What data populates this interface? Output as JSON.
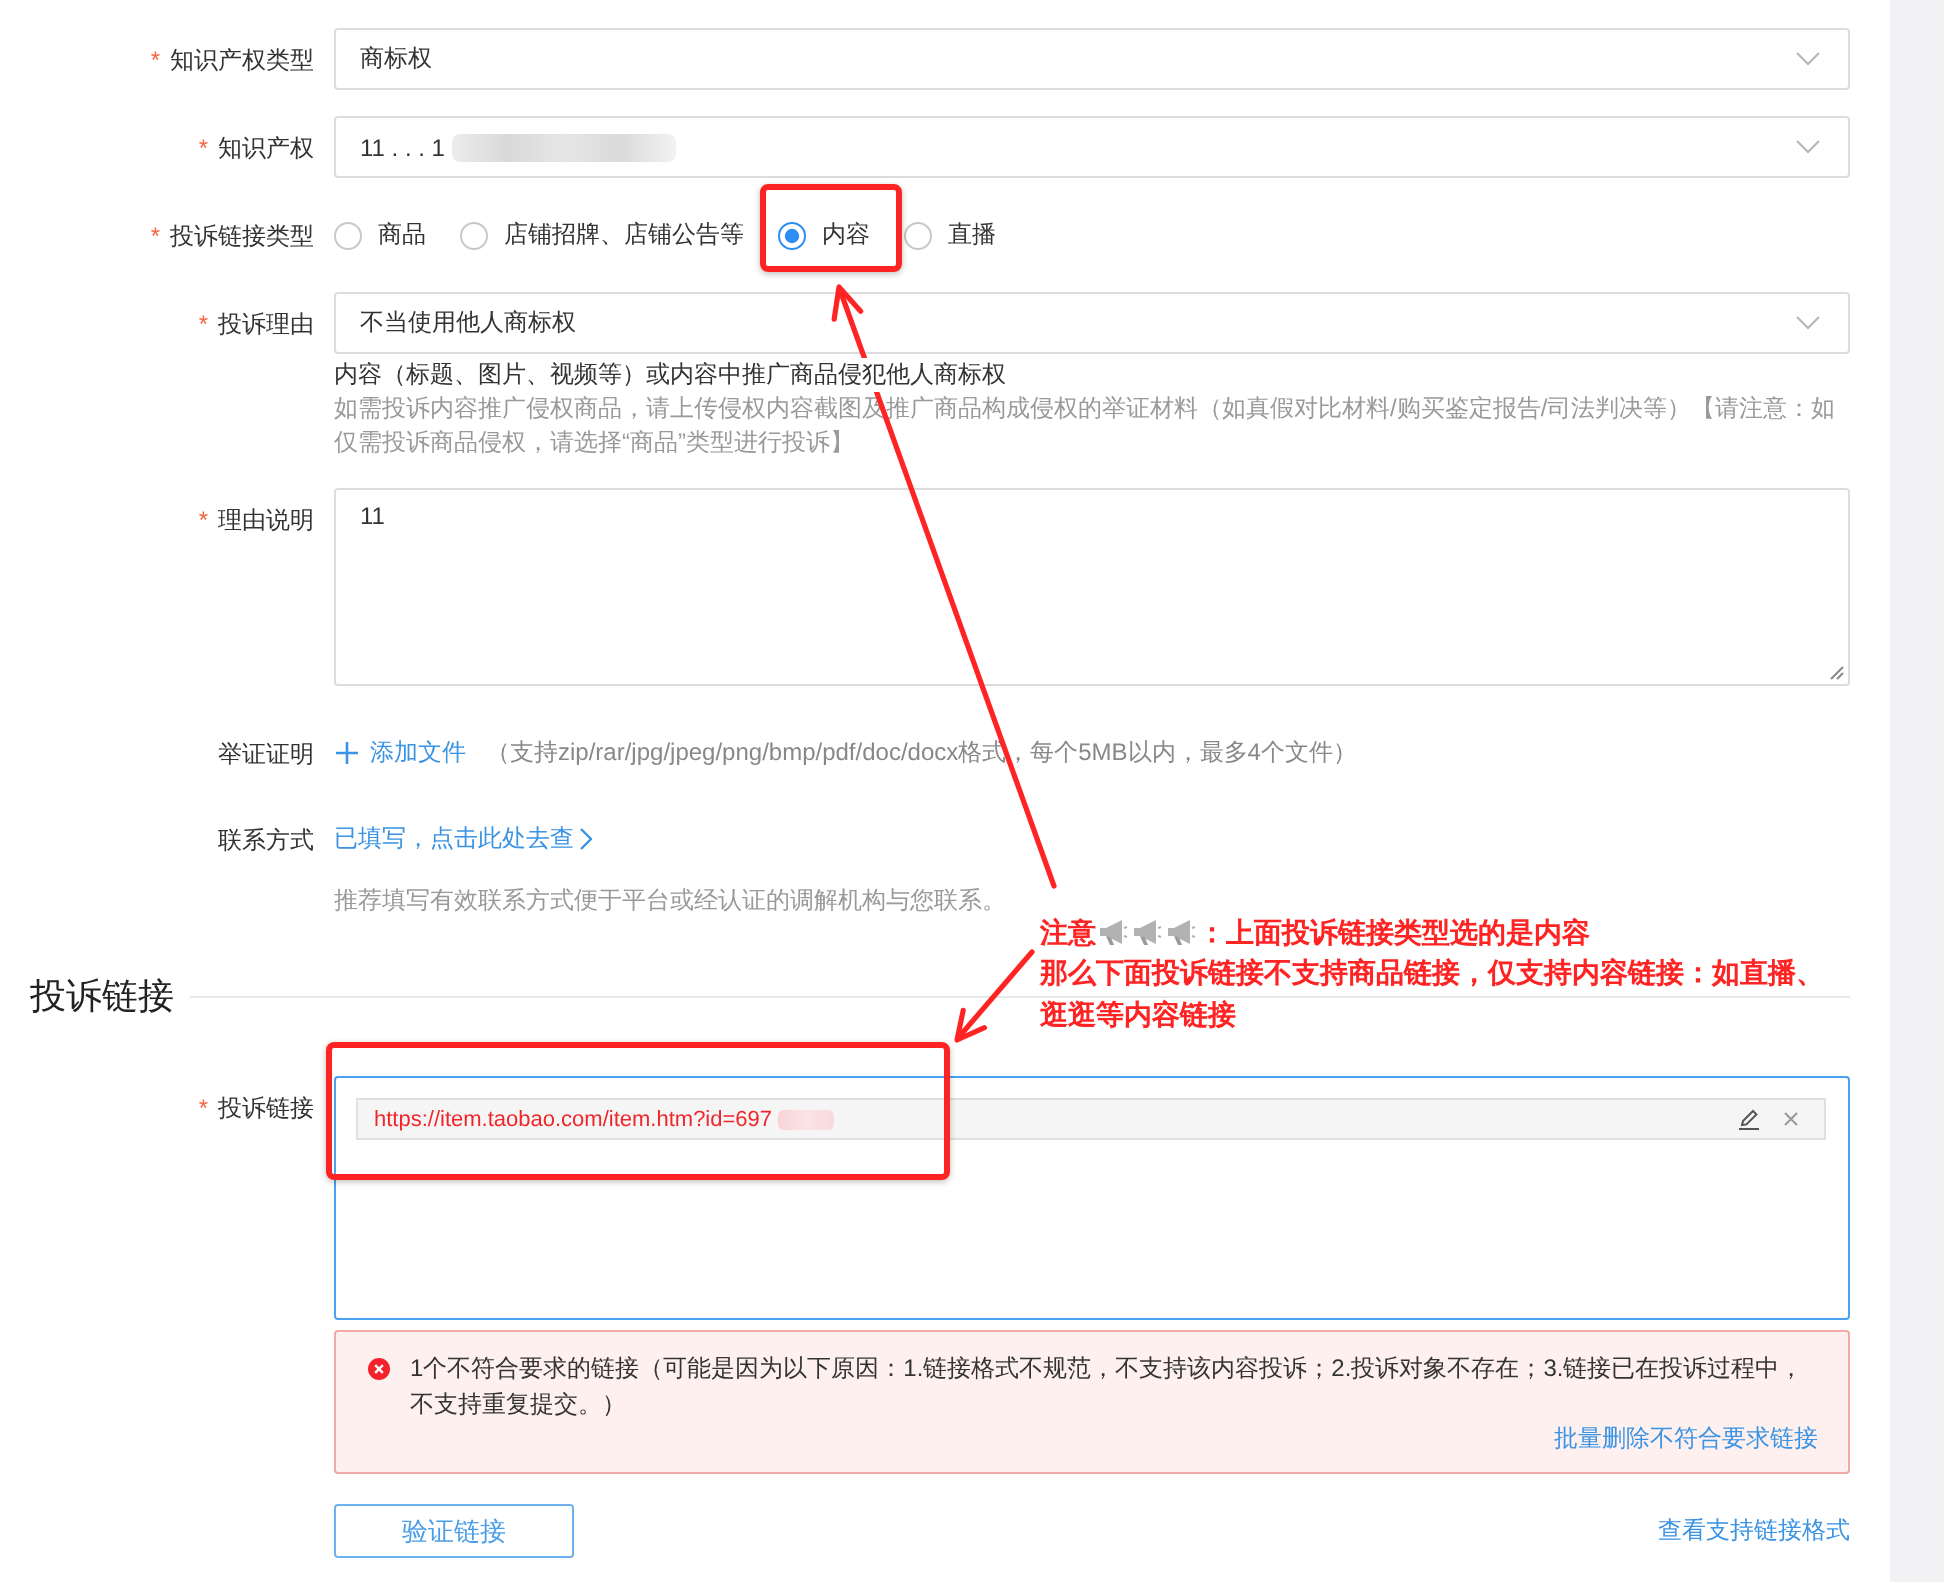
{
  "form": {
    "rows": [
      {
        "kind": "select",
        "mark": "*",
        "label": "知识产权类型",
        "value": "商标权"
      },
      {
        "kind": "select",
        "mark": "*",
        "label": "知识产权",
        "value": "11 . . . 1",
        "redacted": true
      },
      {
        "kind": "radio",
        "mark": "*",
        "label": "投诉链接类型",
        "options": [
          {
            "label": "商品",
            "selected": false
          },
          {
            "label": "店铺招牌、店铺公告等",
            "selected": false
          },
          {
            "label": "内容",
            "selected": true
          },
          {
            "label": "直播",
            "selected": false
          }
        ]
      },
      {
        "kind": "select",
        "mark": "*",
        "label": "投诉理由",
        "value": "不当使用他人商标权",
        "description": "内容（标题、图片、视频等）或内容中推广商品侵犯他人商标权",
        "hint": "如需投诉内容推广侵权商品，请上传侵权内容截图及推广商品构成侵权的举证材料（如真假对比材料/购买鉴定报告/司法判决等）【请注意：如仅需投诉商品侵权，请选择“商品”类型进行投诉】"
      },
      {
        "kind": "textarea",
        "mark": "*",
        "label": "理由说明",
        "value": "11"
      },
      {
        "kind": "upload",
        "label": "举证证明",
        "action": "添加文件",
        "hint": "（支持zip/rar/jpg/jpeg/png/bmp/pdf/doc/docx格式，每个5MB以内，最多4个文件）"
      },
      {
        "kind": "contact",
        "label": "联系方式",
        "link": "已填写，点击此处去查",
        "hint": "推荐填写有效联系方式便于平台或经认证的调解机构与您联系。"
      }
    ]
  },
  "complaint_links": {
    "title": "投诉链接",
    "mark": "*",
    "label": "投诉链接",
    "links": [
      {
        "url": "https://item.taobao.com/item.htm?id=697",
        "redacted": true
      }
    ],
    "error": {
      "message": "1个不符合要求的链接（可能是因为以下原因：1.链接格式不规范，不支持该内容投诉；2.投诉对象不存在；3.链接已在投诉过程中，不支持重复提交。）",
      "action": "批量删除不符合要求链接"
    },
    "verify_button": "验证链接",
    "format_link": "查看支持链接格式"
  },
  "annotation": {
    "lead": "注意",
    "headline": "：上面投诉链接类型选的是内容",
    "body": "那么下面投诉链接不支持商品链接，仅支持内容链接：如直播、逛逛等内容链接"
  }
}
